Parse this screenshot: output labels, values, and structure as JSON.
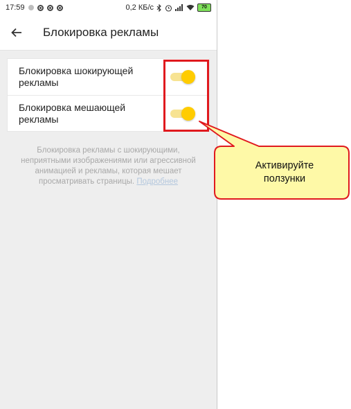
{
  "status_bar": {
    "time": "17:59",
    "speed": "0,2 КБ/с",
    "battery": "70",
    "icons": [
      "notification-dot-icon",
      "notification-icon",
      "notification-icon",
      "notification-icon",
      "bluetooth-icon",
      "alarm-icon",
      "signal-icon",
      "wifi-icon",
      "battery-icon"
    ]
  },
  "toolbar": {
    "back_icon": "arrow-left-icon",
    "title": "Блокировка рекламы"
  },
  "settings": {
    "items": [
      {
        "label": "Блокировка шокирующей рекламы",
        "enabled": true
      },
      {
        "label": "Блокировка мешающей рекламы",
        "enabled": true
      }
    ]
  },
  "description": {
    "text": "Блокировка рекламы с шокирующими, неприятными изображениями или агрессивной анимацией и рекламы, которая мешает просматривать страницы.",
    "link": "Подробнее"
  },
  "annotation": {
    "text": "Активируйте\nползунки"
  },
  "colors": {
    "toggle_thumb": "#ffcc00",
    "toggle_track": "#f7e392",
    "highlight_border": "#e0191e",
    "callout_fill": "#fef9a7"
  }
}
